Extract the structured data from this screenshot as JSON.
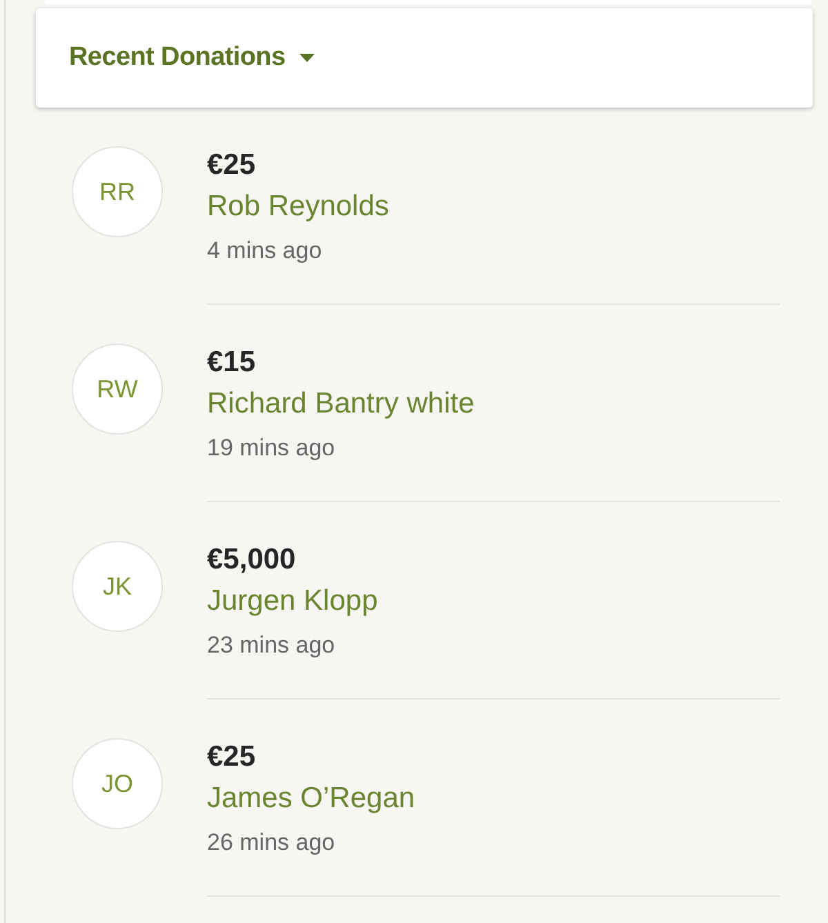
{
  "header": {
    "title": "Recent Donations"
  },
  "donations": [
    {
      "initials": "RR",
      "amount": "€25",
      "name": "Rob Reynolds",
      "time": "4 mins ago"
    },
    {
      "initials": "RW",
      "amount": "€15",
      "name": "Richard Bantry white",
      "time": "19 mins ago"
    },
    {
      "initials": "JK",
      "amount": "€5,000",
      "name": "Jurgen Klopp",
      "time": "23 mins ago"
    },
    {
      "initials": "JO",
      "amount": "€25",
      "name": "James O’Regan",
      "time": "26 mins ago"
    }
  ]
}
